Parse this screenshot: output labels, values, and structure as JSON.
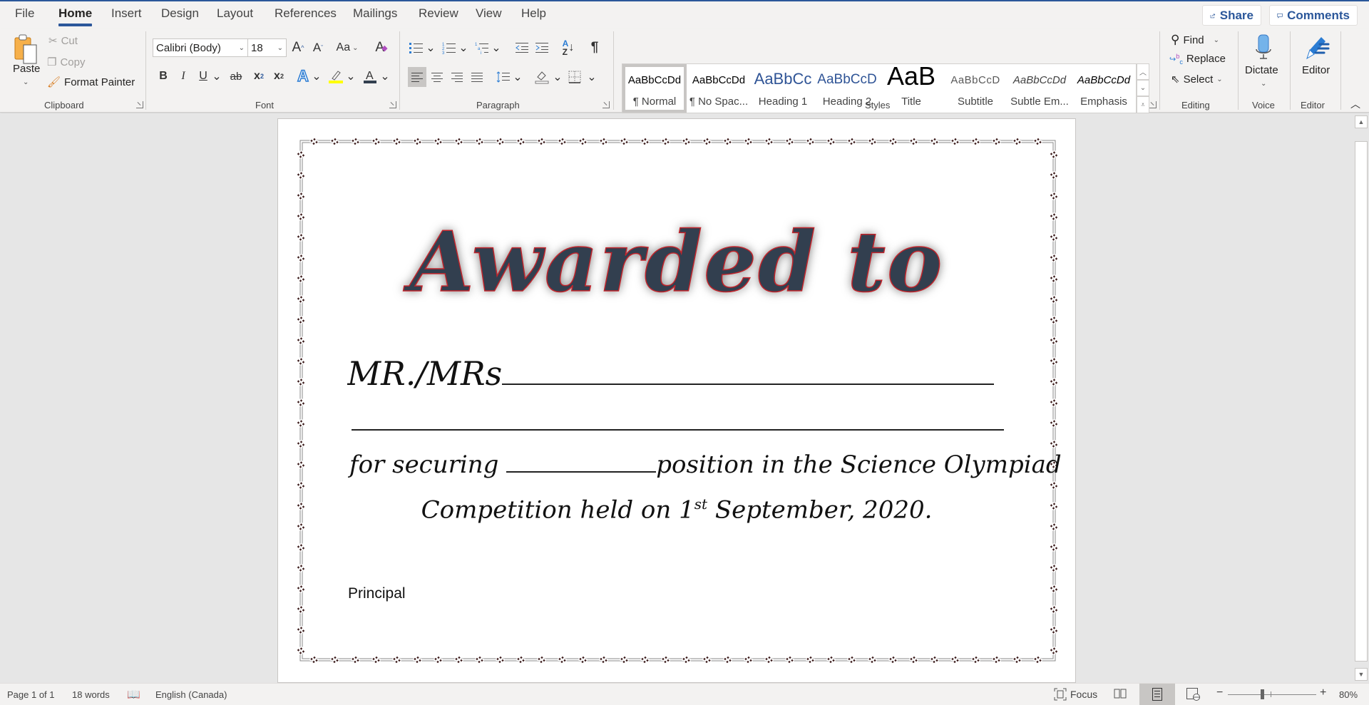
{
  "tabs": [
    {
      "label": "File"
    },
    {
      "label": "Home"
    },
    {
      "label": "Insert"
    },
    {
      "label": "Design"
    },
    {
      "label": "Layout"
    },
    {
      "label": "References"
    },
    {
      "label": "Mailings"
    },
    {
      "label": "Review"
    },
    {
      "label": "View"
    },
    {
      "label": "Help"
    }
  ],
  "active_tab": "Home",
  "header": {
    "share_label": "Share",
    "comments_label": "Comments"
  },
  "clipboard": {
    "paste": "Paste",
    "cut": "Cut",
    "copy": "Copy",
    "format_painter": "Format Painter",
    "label": "Clipboard"
  },
  "font": {
    "name": "Calibri (Body)",
    "size": "18",
    "label": "Font",
    "change_case": "Aa"
  },
  "paragraph": {
    "label": "Paragraph"
  },
  "styles": {
    "label": "Styles",
    "items": [
      {
        "sample": "AaBbCcDd",
        "name": "¶ Normal",
        "color": "#000000"
      },
      {
        "sample": "AaBbCcDd",
        "name": "¶ No Spac...",
        "color": "#000000"
      },
      {
        "sample": "AaBbCc",
        "name": "Heading 1",
        "color": "#2f5496"
      },
      {
        "sample": "AaBbCcD",
        "name": "Heading 2",
        "color": "#2f5496"
      },
      {
        "sample": "AaB",
        "name": "Title",
        "color": "#000000"
      },
      {
        "sample": "AaBbCcD",
        "name": "Subtitle",
        "color": "#595959"
      },
      {
        "sample": "AaBbCcDd",
        "name": "Subtle Em...",
        "color": "#404040"
      },
      {
        "sample": "AaBbCcDd",
        "name": "Emphasis",
        "color": "#000000"
      }
    ],
    "selected": "¶ Normal"
  },
  "editing": {
    "find": "Find",
    "replace": "Replace",
    "select": "Select",
    "label": "Editing"
  },
  "voice": {
    "dictate": "Dictate",
    "label": "Voice"
  },
  "editor": {
    "editor": "Editor",
    "label": "Editor"
  },
  "document": {
    "headline": "Awarded to",
    "salutation": "MR./MRs",
    "line3_prefix": "for securing ",
    "line3_suffix": "position in the Science Olympiad",
    "line4_prefix": "Competition held on 1",
    "line4_sup": "st",
    "line4_suffix": " September, 2020.",
    "signature": "Principal"
  },
  "status": {
    "page": "Page 1 of 1",
    "words": "18 words",
    "language": "English (Canada)",
    "focus": "Focus",
    "zoom": "80%",
    "zoom_level": 0.8
  },
  "colors": {
    "accent": "#2b579a",
    "headline_fill": "#323f4f",
    "headline_outline": "#c0242b",
    "highlight": "#ffff00"
  }
}
